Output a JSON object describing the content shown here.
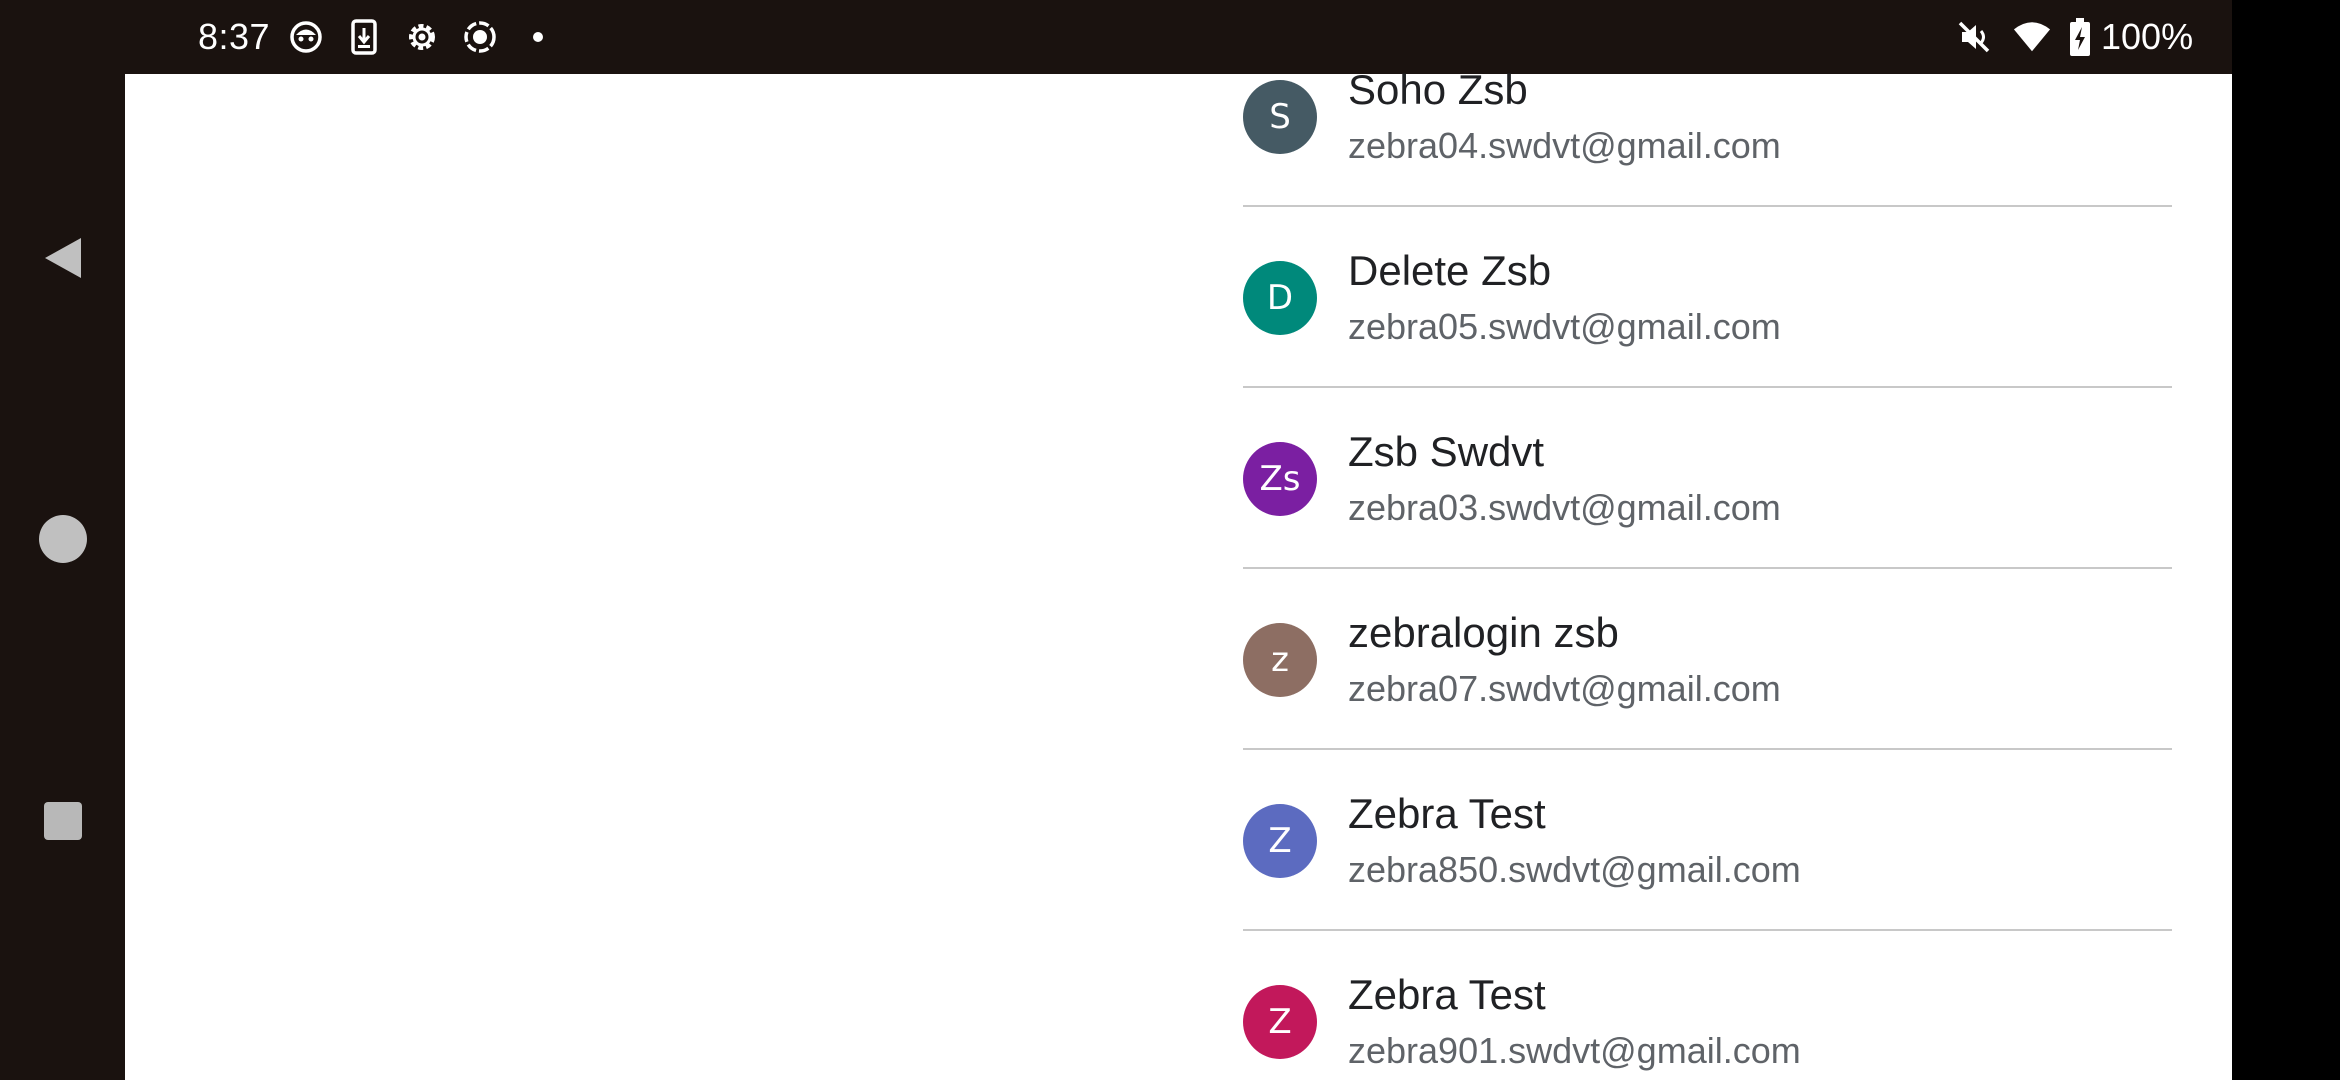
{
  "status_bar": {
    "time": "8:37",
    "battery_percent": "100%",
    "left_icons": [
      "face-icon",
      "download-icon",
      "gear-icon",
      "screen-record-icon",
      "dot-icon"
    ],
    "right_icons": [
      "vibrate-off-icon",
      "wifi-icon",
      "battery-charging-icon"
    ]
  },
  "navigation": {
    "buttons": [
      "back-icon",
      "home-icon",
      "recents-icon"
    ]
  },
  "accounts": [
    {
      "initial": "S",
      "name": "Soho Zsb",
      "email": "zebra04.swdvt@gmail.com",
      "color": "#455a64"
    },
    {
      "initial": "D",
      "name": "Delete Zsb",
      "email": "zebra05.swdvt@gmail.com",
      "color": "#00897b"
    },
    {
      "initial": "Zs",
      "name": "Zsb Swdvt",
      "email": "zebra03.swdvt@gmail.com",
      "color": "#7b1fa2"
    },
    {
      "initial": "z",
      "name": "zebralogin zsb",
      "email": "zebra07.swdvt@gmail.com",
      "color": "#8d6e63"
    },
    {
      "initial": "Z",
      "name": "Zebra Test",
      "email": "zebra850.swdvt@gmail.com",
      "color": "#5c6bc0"
    },
    {
      "initial": "Z",
      "name": "Zebra Test",
      "email": "zebra901.swdvt@gmail.com",
      "color": "#c2185b"
    }
  ]
}
